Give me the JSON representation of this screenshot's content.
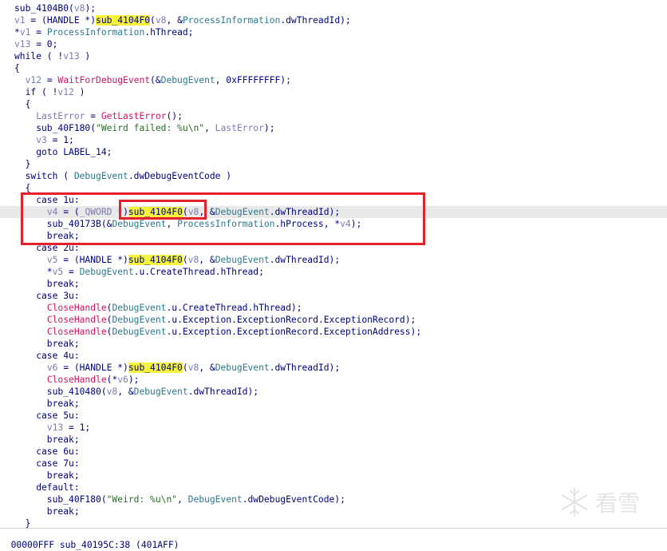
{
  "code_lines": [
    [
      [
        "t-ident",
        "sub_4104B0("
      ],
      [
        "t-var",
        "v8"
      ],
      [
        "t-ident",
        ");"
      ]
    ],
    [
      [
        "t-var",
        "v1"
      ],
      [
        "t-ident",
        " = (HANDLE *)"
      ],
      [
        "t-hl",
        "sub_4104F0"
      ],
      [
        "t-ident",
        "("
      ],
      [
        "t-var",
        "v8"
      ],
      [
        "t-ident",
        ", &"
      ],
      [
        "t-field",
        "ProcessInformation"
      ],
      [
        "t-ident",
        ".dwThreadId);"
      ]
    ],
    [
      [
        "t-ident",
        "*"
      ],
      [
        "t-var",
        "v1"
      ],
      [
        "t-ident",
        " = "
      ],
      [
        "t-field",
        "ProcessInformation"
      ],
      [
        "t-ident",
        ".hThread;"
      ]
    ],
    [
      [
        "t-var",
        "v13"
      ],
      [
        "t-ident",
        " = 0;"
      ]
    ],
    [
      [
        "t-ident",
        "while ( !"
      ],
      [
        "t-var",
        "v13"
      ],
      [
        "t-ident",
        " )"
      ]
    ],
    [
      [
        "t-ident",
        "{"
      ]
    ],
    [
      [
        "t-ident",
        "  "
      ],
      [
        "t-var",
        "v12"
      ],
      [
        "t-ident",
        " = "
      ],
      [
        "t-func",
        "WaitForDebugEvent"
      ],
      [
        "t-ident",
        "(&"
      ],
      [
        "t-field",
        "DebugEvent"
      ],
      [
        "t-ident",
        ", 0xFFFFFFFF);"
      ]
    ],
    [
      [
        "t-ident",
        "  if ( !"
      ],
      [
        "t-var",
        "v12"
      ],
      [
        "t-ident",
        " )"
      ]
    ],
    [
      [
        "t-ident",
        "  {"
      ]
    ],
    [
      [
        "t-ident",
        "    "
      ],
      [
        "t-var",
        "LastError"
      ],
      [
        "t-ident",
        " = "
      ],
      [
        "t-func",
        "GetLastError"
      ],
      [
        "t-ident",
        "();"
      ]
    ],
    [
      [
        "t-ident",
        "    sub_40F180("
      ],
      [
        "t-str",
        "\"Weird failed: %u\\n\""
      ],
      [
        "t-ident",
        ", "
      ],
      [
        "t-var",
        "LastError"
      ],
      [
        "t-ident",
        ");"
      ]
    ],
    [
      [
        "t-ident",
        "    "
      ],
      [
        "t-var",
        "v3"
      ],
      [
        "t-ident",
        " = 1;"
      ]
    ],
    [
      [
        "t-ident",
        "    goto LABEL_14;"
      ]
    ],
    [
      [
        "t-ident",
        "  }"
      ]
    ],
    [
      [
        "t-ident",
        "  switch ( "
      ],
      [
        "t-field",
        "DebugEvent"
      ],
      [
        "t-ident",
        ".dwDebugEventCode )"
      ]
    ],
    [
      [
        "t-ident",
        "  {"
      ]
    ],
    [
      [
        "t-ident",
        "    case 1u:"
      ]
    ],
    [
      [
        "t-ident",
        "      "
      ],
      [
        "t-var",
        "v4"
      ],
      [
        "t-ident",
        " = ("
      ],
      [
        "t-cast",
        "_QWORD *"
      ],
      [
        "t-ident",
        ")"
      ],
      [
        "t-hl",
        "sub_4104F0"
      ],
      [
        "t-ident",
        "("
      ],
      [
        "t-var",
        "v8"
      ],
      [
        "t-ident",
        ", &"
      ],
      [
        "t-field",
        "DebugEvent"
      ],
      [
        "t-ident",
        ".dwThreadId);"
      ]
    ],
    [
      [
        "t-ident",
        "      sub_40173B(&"
      ],
      [
        "t-field",
        "DebugEvent"
      ],
      [
        "t-ident",
        ", "
      ],
      [
        "t-field",
        "ProcessInformation"
      ],
      [
        "t-ident",
        ".hProcess, *"
      ],
      [
        "t-var",
        "v4"
      ],
      [
        "t-ident",
        ");"
      ]
    ],
    [
      [
        "t-ident",
        "      break;"
      ]
    ],
    [
      [
        "t-ident",
        "    case 2u:"
      ]
    ],
    [
      [
        "t-ident",
        "      "
      ],
      [
        "t-var",
        "v5"
      ],
      [
        "t-ident",
        " = (HANDLE *)"
      ],
      [
        "t-hl",
        "sub_4104F0"
      ],
      [
        "t-ident",
        "("
      ],
      [
        "t-var",
        "v8"
      ],
      [
        "t-ident",
        ", &"
      ],
      [
        "t-field",
        "DebugEvent"
      ],
      [
        "t-ident",
        ".dwThreadId);"
      ]
    ],
    [
      [
        "t-ident",
        "      *"
      ],
      [
        "t-var",
        "v5"
      ],
      [
        "t-ident",
        " = "
      ],
      [
        "t-field",
        "DebugEvent"
      ],
      [
        "t-ident",
        ".u.CreateThread.hThread;"
      ]
    ],
    [
      [
        "t-ident",
        "      break;"
      ]
    ],
    [
      [
        "t-ident",
        "    case 3u:"
      ]
    ],
    [
      [
        "t-ident",
        "      "
      ],
      [
        "t-func",
        "CloseHandle"
      ],
      [
        "t-ident",
        "("
      ],
      [
        "t-field",
        "DebugEvent"
      ],
      [
        "t-ident",
        ".u.CreateThread.hThread);"
      ]
    ],
    [
      [
        "t-ident",
        "      "
      ],
      [
        "t-func",
        "CloseHandle"
      ],
      [
        "t-ident",
        "("
      ],
      [
        "t-field",
        "DebugEvent"
      ],
      [
        "t-ident",
        ".u.Exception.ExceptionRecord.ExceptionRecord);"
      ]
    ],
    [
      [
        "t-ident",
        "      "
      ],
      [
        "t-func",
        "CloseHandle"
      ],
      [
        "t-ident",
        "("
      ],
      [
        "t-field",
        "DebugEvent"
      ],
      [
        "t-ident",
        ".u.Exception.ExceptionRecord.ExceptionAddress);"
      ]
    ],
    [
      [
        "t-ident",
        "      break;"
      ]
    ],
    [
      [
        "t-ident",
        "    case 4u:"
      ]
    ],
    [
      [
        "t-ident",
        "      "
      ],
      [
        "t-var",
        "v6"
      ],
      [
        "t-ident",
        " = (HANDLE *)"
      ],
      [
        "t-hl",
        "sub_4104F0"
      ],
      [
        "t-ident",
        "("
      ],
      [
        "t-var",
        "v8"
      ],
      [
        "t-ident",
        ", &"
      ],
      [
        "t-field",
        "DebugEvent"
      ],
      [
        "t-ident",
        ".dwThreadId);"
      ]
    ],
    [
      [
        "t-ident",
        "      "
      ],
      [
        "t-func",
        "CloseHandle"
      ],
      [
        "t-ident",
        "(*"
      ],
      [
        "t-var",
        "v6"
      ],
      [
        "t-ident",
        ");"
      ]
    ],
    [
      [
        "t-ident",
        "      sub_410480("
      ],
      [
        "t-var",
        "v8"
      ],
      [
        "t-ident",
        ", &"
      ],
      [
        "t-field",
        "DebugEvent"
      ],
      [
        "t-ident",
        ".dwThreadId);"
      ]
    ],
    [
      [
        "t-ident",
        "      break;"
      ]
    ],
    [
      [
        "t-ident",
        "    case 5u:"
      ]
    ],
    [
      [
        "t-ident",
        "      "
      ],
      [
        "t-var",
        "v13"
      ],
      [
        "t-ident",
        " = 1;"
      ]
    ],
    [
      [
        "t-ident",
        "      break;"
      ]
    ],
    [
      [
        "t-ident",
        "    case 6u:"
      ]
    ],
    [
      [
        "t-ident",
        "    case 7u:"
      ]
    ],
    [
      [
        "t-ident",
        "      break;"
      ]
    ],
    [
      [
        "t-ident",
        "    default:"
      ]
    ],
    [
      [
        "t-ident",
        "      sub_40F180("
      ],
      [
        "t-str",
        "\"Weird: %u\\n\""
      ],
      [
        "t-ident",
        ", "
      ],
      [
        "t-field",
        "DebugEvent"
      ],
      [
        "t-ident",
        ".dwDebugEventCode);"
      ]
    ],
    [
      [
        "t-ident",
        "      break;"
      ]
    ],
    [
      [
        "t-ident",
        "  }"
      ]
    ]
  ],
  "current_line_index": 17,
  "status_bar": {
    "text": "00000FFF sub_40195C:38 (401AFF)"
  },
  "watermark": {
    "text": "看雪"
  },
  "colors": {
    "annotation_red": "#e5212a",
    "identifier_highlight": "#f4f43e"
  }
}
